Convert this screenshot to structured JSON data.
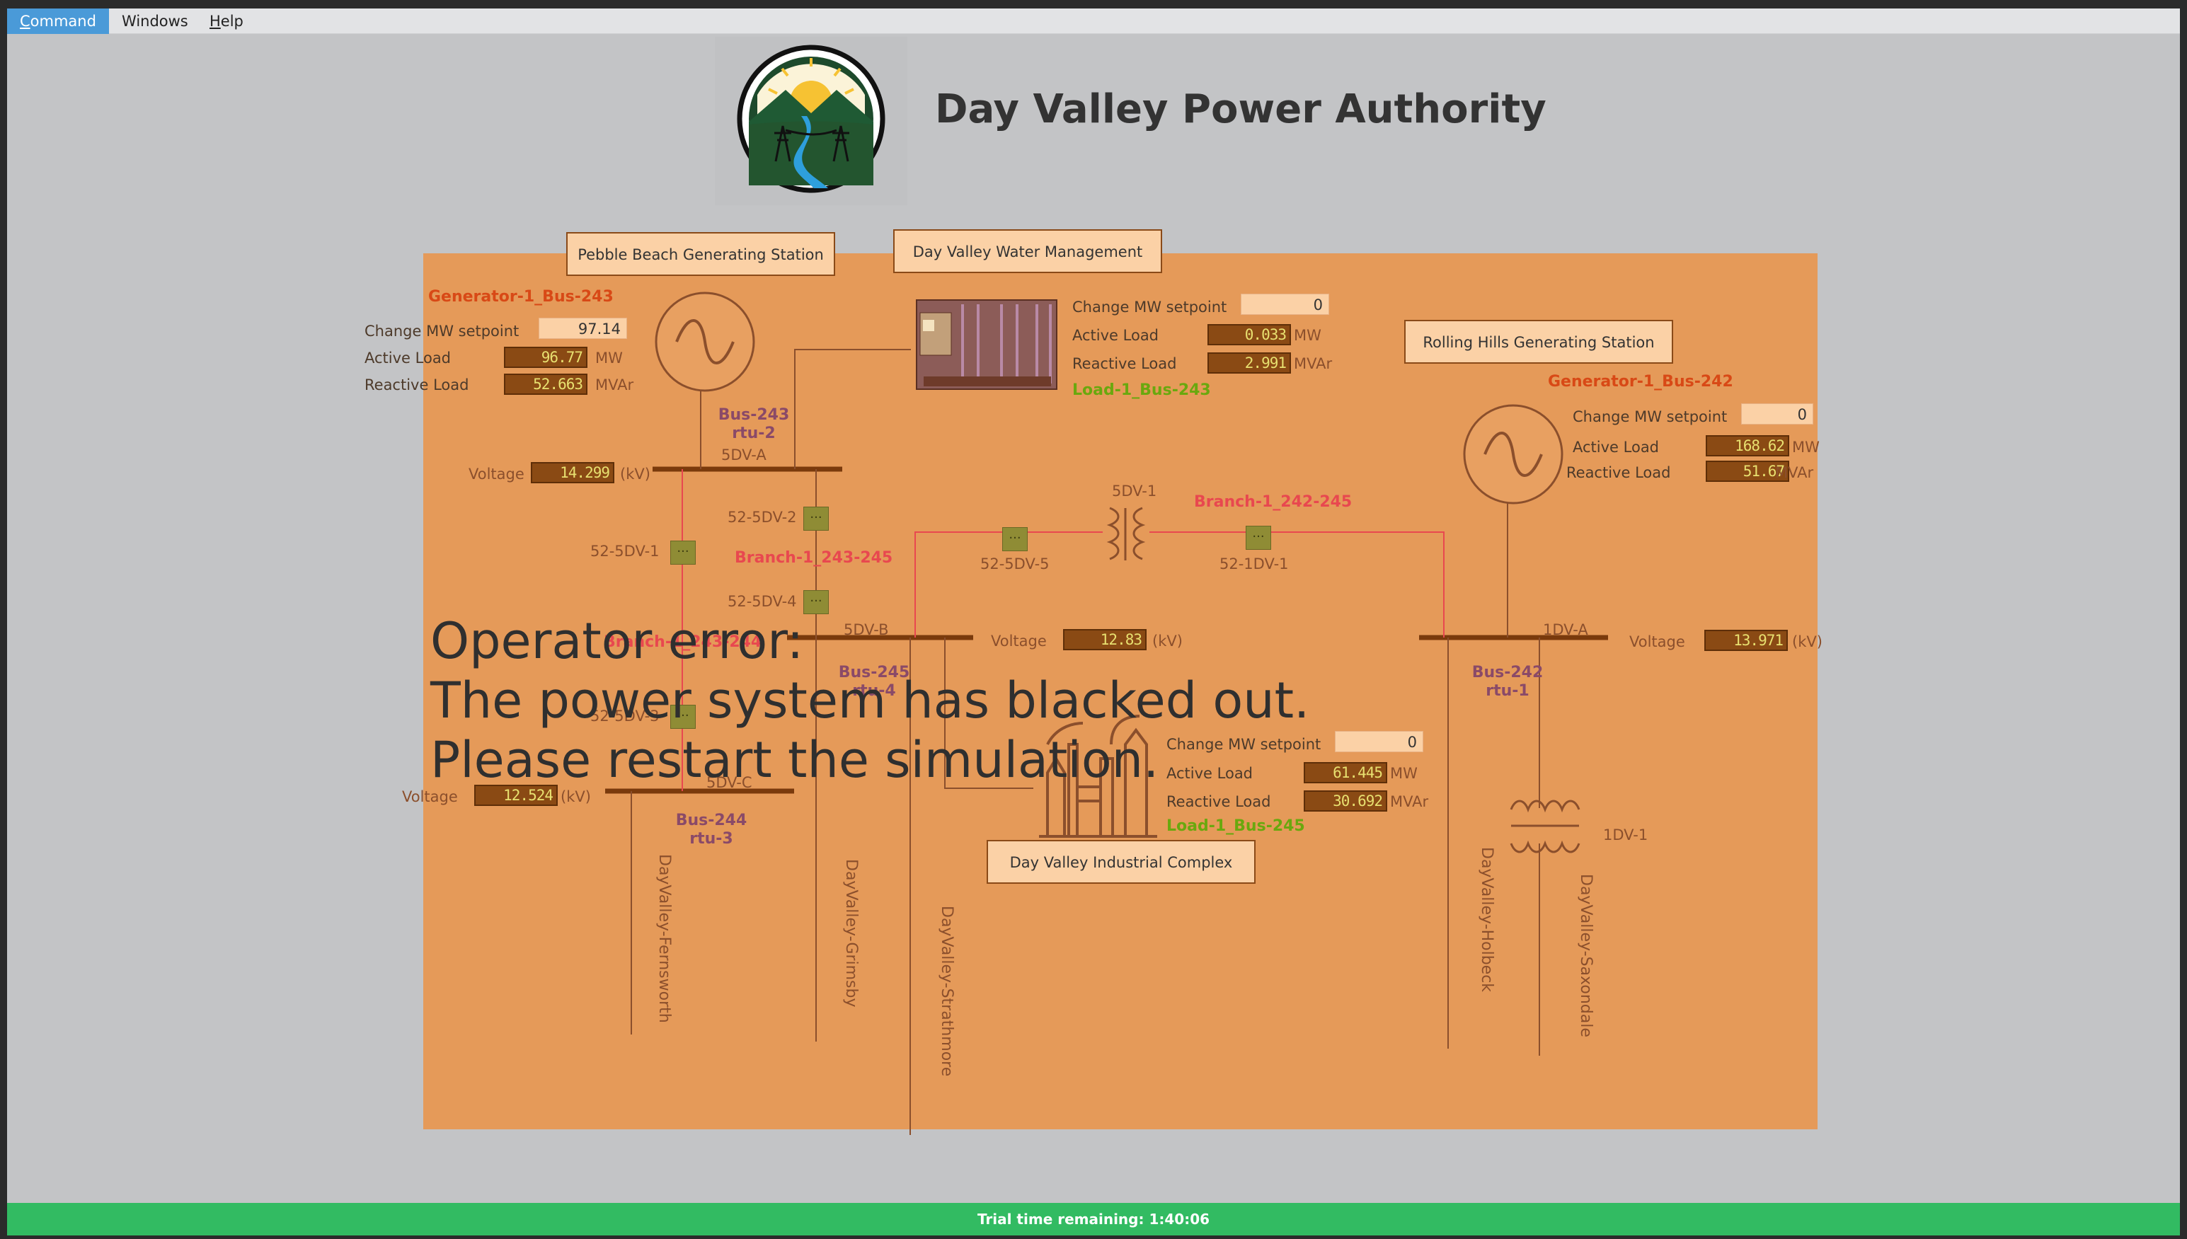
{
  "menu": {
    "command": {
      "first": "C",
      "rest": "ommand"
    },
    "windows": {
      "first": "W",
      "rest": "indows"
    },
    "help": {
      "first": "H",
      "rest": "elp"
    }
  },
  "header": {
    "title": "Day Valley Power Authority"
  },
  "stations": {
    "pebble": "Pebble Beach Generating Station",
    "water": "Day Valley Water Management",
    "rolling": "Rolling Hills Generating Station",
    "industrial": "Day Valley Industrial Complex"
  },
  "labels": {
    "change_mw": "Change MW setpoint",
    "active_load": "Active Load",
    "reactive_load": "Reactive Load",
    "voltage": "Voltage",
    "mw": "MW",
    "mvar": "MVAr",
    "kv": "(kV)"
  },
  "generators": {
    "g243": {
      "name": "Generator-1_Bus-243",
      "setpoint": "97.14",
      "active": "96.77",
      "reactive": "52.663"
    },
    "g242": {
      "name": "Generator-1_Bus-242",
      "setpoint": "0",
      "active": "168.62",
      "reactive": "51.67"
    }
  },
  "loads": {
    "l243": {
      "name": "Load-1_Bus-243",
      "setpoint": "0",
      "active": "0.033",
      "reactive": "2.991"
    },
    "l245": {
      "name": "Load-1_Bus-245",
      "setpoint": "0",
      "active": "61.445",
      "reactive": "30.692"
    }
  },
  "buses": {
    "b243": {
      "name": "Bus-243",
      "rtu": "rtu-2",
      "id": "5DV-A",
      "voltage": "14.299"
    },
    "b245": {
      "name": "Bus-245",
      "rtu": "rtu-4",
      "id": "5DV-B",
      "voltage": "12.83"
    },
    "b244": {
      "name": "Bus-244",
      "rtu": "rtu-3",
      "id": "5DV-C",
      "voltage": "12.524"
    },
    "b242": {
      "name": "Bus-242",
      "rtu": "rtu-1",
      "id": "1DV-A",
      "voltage": "13.971"
    }
  },
  "breakers": {
    "b52_5dv_1": "52-5DV-1",
    "b52_5dv_2": "52-5DV-2",
    "b52_5dv_3": "52-5DV-3",
    "b52_5dv_4": "52-5DV-4",
    "b52_5dv_5": "52-5DV-5",
    "b52_1dv_1": "52-1DV-1",
    "glyph": "..."
  },
  "branches": {
    "br_243_245": "Branch-1_243-245",
    "br_242_245": "Branch-1_242-245",
    "br_243_244": "Branch-1_243-244"
  },
  "transformers": {
    "t5dv1": "5DV-1",
    "t1dv1": "1DV-1"
  },
  "lines": {
    "fernsworth": "DayValley-Fernsworth",
    "grimsby": "DayValley-Grimsby",
    "strathmore": "DayValley-Strathmore",
    "holbeck": "DayValley-Holbeck",
    "saxondale": "DayValley-Saxondale"
  },
  "error": {
    "line1": "Operator error:",
    "line2": "The power system has blacked out.",
    "line3": "Please restart the simulation."
  },
  "status": {
    "trial": "Trial time remaining: 1:40:06"
  },
  "colors": {
    "panel": "#e59a59",
    "bus_bar": "#7a3a0c",
    "breaker": "#8f8c35",
    "generator_name": "#d84916",
    "load_name": "#6aa80e",
    "branch_name": "#e8484f",
    "status_bar": "#32bb62",
    "menu_active": "#4a9ad8"
  }
}
